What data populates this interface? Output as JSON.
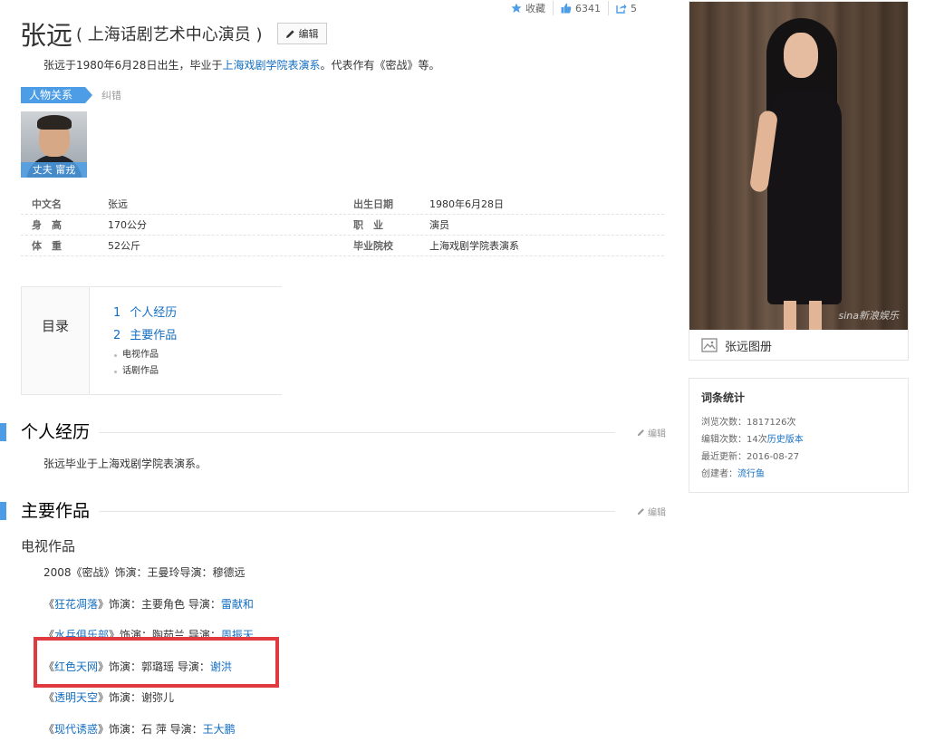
{
  "top_actions": {
    "favorite": "收藏",
    "likes": "6341",
    "shares": "5"
  },
  "title": {
    "name": "张远",
    "subtitle": "( 上海话剧艺术中心演员 )",
    "edit_label": "编辑"
  },
  "summary": {
    "before": "张远于1980年6月28日出生，毕业于",
    "link": "上海戏剧学院表演系",
    "after": "。代表作有《密战》等。"
  },
  "relation": {
    "tab_label": "人物关系",
    "correct_label": "纠错",
    "card_caption": "丈夫 甯戎"
  },
  "basic_info": [
    {
      "name": "中文名",
      "value": "张远",
      "name2": "出生日期",
      "value2": "1980年6月28日"
    },
    {
      "name": "身　高",
      "value": "170公分",
      "name2": "职　业",
      "value2": "演员"
    },
    {
      "name": "体　重",
      "value": "52公斤",
      "name2": "毕业院校",
      "value2": "上海戏剧学院表演系"
    }
  ],
  "catalog": {
    "title": "目录",
    "items": [
      {
        "num": "1",
        "label": "个人经历"
      },
      {
        "num": "2",
        "label": "主要作品"
      }
    ],
    "subitems": [
      "电视作品",
      "话剧作品"
    ]
  },
  "sections": {
    "bio_title": "个人经历",
    "bio_text": "张远毕业于上海戏剧学院表演系。",
    "works_title": "主要作品",
    "edit_label": "编辑",
    "tv_subhead": "电视作品"
  },
  "works": [
    {
      "prefix": "2008《密战》",
      "title": "",
      "suffix": "饰演：王曼玲导演：穆德远",
      "director": ""
    },
    {
      "prefix": "《",
      "title": "狂花凋落",
      "suffix": "》饰演：主要角色 导演：",
      "director": "雷献和"
    },
    {
      "prefix": "《",
      "title": "水兵俱乐部",
      "suffix": "》饰演：陶茹兰 导演：",
      "director": "周振天"
    },
    {
      "prefix": "《",
      "title": "红色天网",
      "suffix": "》饰演：郭璐瑶 导演：",
      "director": "谢洪"
    },
    {
      "prefix": "《",
      "title": "透明天空",
      "suffix": "》饰演：谢弥儿",
      "director": ""
    },
    {
      "prefix": "《",
      "title": "现代诱惑",
      "suffix": "》饰演：石 萍 导演：",
      "director": "王大鹏"
    }
  ],
  "album": {
    "label": "张远图册",
    "watermark": "sina新浪娱乐"
  },
  "stats": {
    "title": "词条统计",
    "views_label": "浏览次数：",
    "views": "1817126次",
    "edits_label": "编辑次数：",
    "edits": "14次",
    "history_link": "历史版本",
    "updated_label": "最近更新：",
    "updated": "2016-08-27",
    "creator_label": "创建者：",
    "creator": "流行鱼"
  },
  "colors": {
    "accent": "#4d9de6",
    "link": "#136ec2",
    "highlight": "#e0393f"
  }
}
